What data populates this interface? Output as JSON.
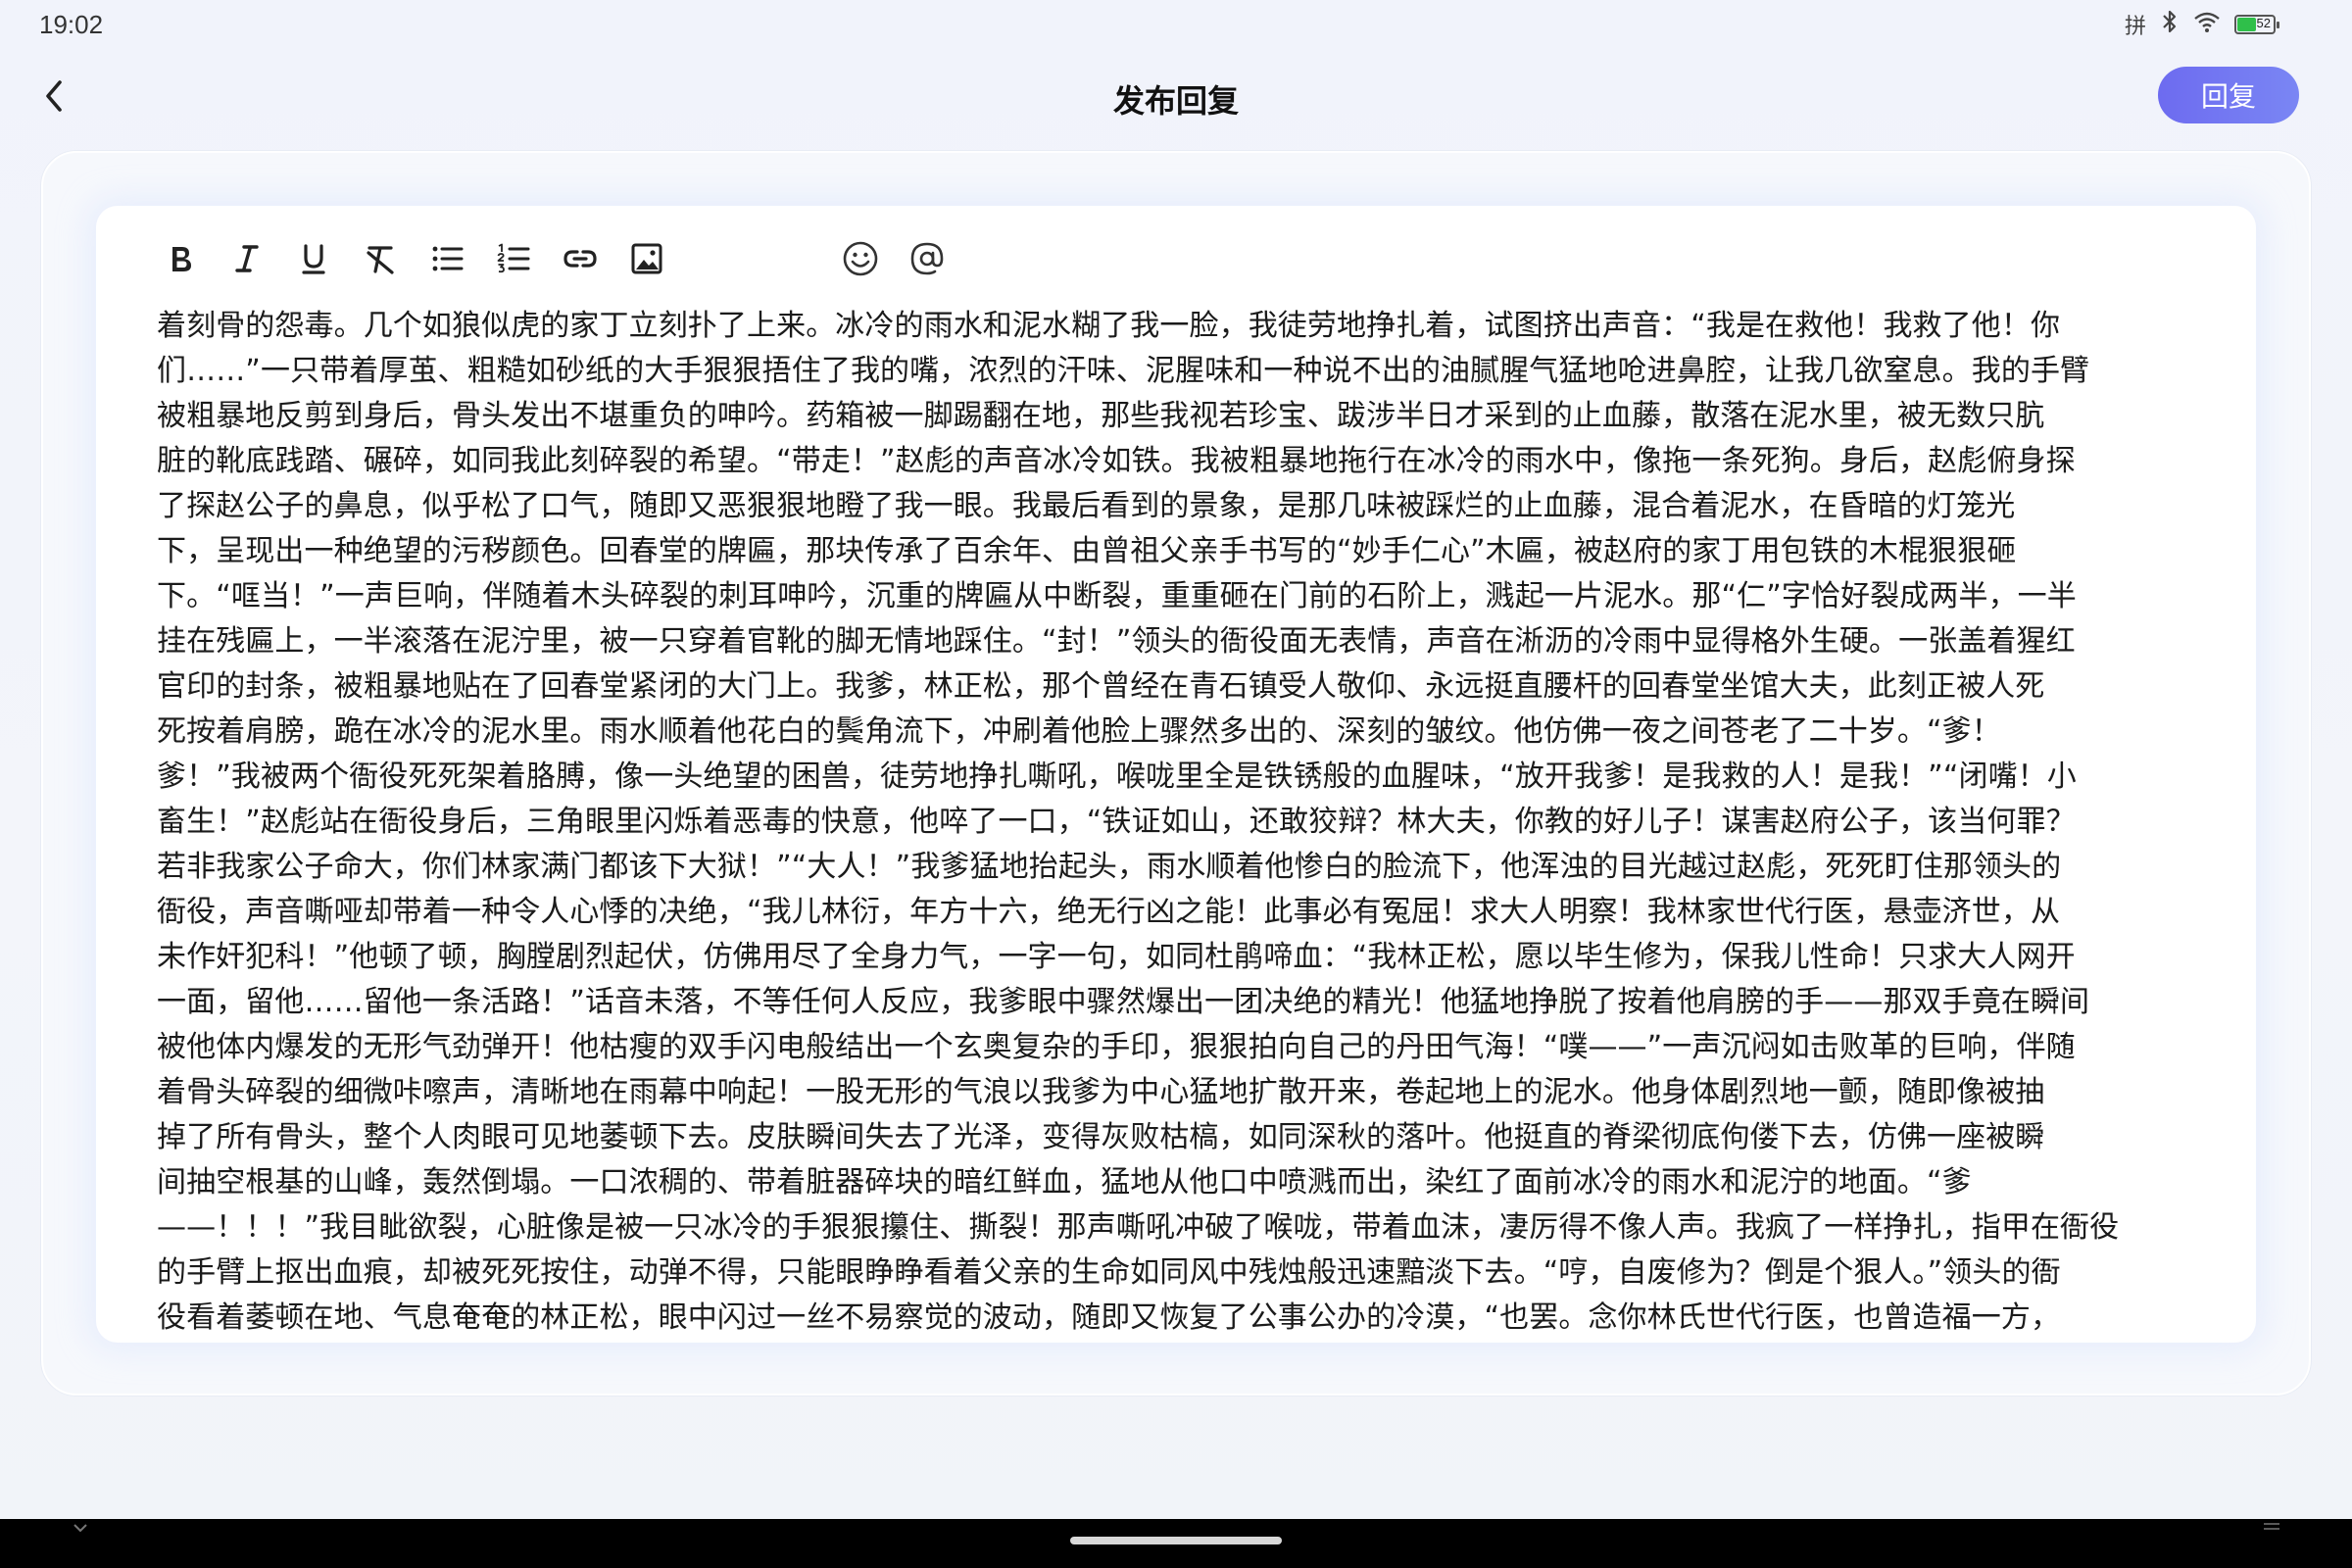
{
  "status_bar": {
    "time": "19:02",
    "input_method": "拼",
    "battery_level": "52",
    "battery_fraction": 0.52,
    "icons": [
      "bluetooth-icon",
      "wifi-icon",
      "battery-icon"
    ]
  },
  "header": {
    "title": "发布回复",
    "reply_label": "回复",
    "accent_color": "#6d6bf0"
  },
  "toolbar": {
    "tools": [
      "bold",
      "italic",
      "underline",
      "clear-format",
      "bullet-list",
      "numbered-list",
      "link",
      "image",
      "emoji",
      "mention"
    ]
  },
  "editor": {
    "lines": [
      "着刻骨的怨毒。几个如狼似虎的家丁立刻扑了上来。冰冷的雨水和泥水糊了我一脸，我徒劳地挣扎着，试图挤出声音：“我是在救他！我救了他！你",
      "们……”一只带着厚茧、粗糙如砂纸的大手狠狠捂住了我的嘴，浓烈的汗味、泥腥味和一种说不出的油腻腥气猛地呛进鼻腔，让我几欲窒息。我的手臂",
      "被粗暴地反剪到身后，骨头发出不堪重负的呻吟。药箱被一脚踢翻在地，那些我视若珍宝、跋涉半日才采到的止血藤，散落在泥水里，被无数只肮",
      "脏的靴底践踏、碾碎，如同我此刻碎裂的希望。“带走！”赵彪的声音冰冷如铁。我被粗暴地拖行在冰冷的雨水中，像拖一条死狗。身后，赵彪俯身探",
      "了探赵公子的鼻息，似乎松了口气，随即又恶狠狠地瞪了我一眼。我最后看到的景象，是那几味被踩烂的止血藤，混合着泥水，在昏暗的灯笼光",
      "下，呈现出一种绝望的污秽颜色。回春堂的牌匾，那块传承了百余年、由曾祖父亲手书写的“妙手仁心”木匾，被赵府的家丁用包铁的木棍狠狠砸",
      "下。“哐当！”一声巨响，伴随着木头碎裂的刺耳呻吟，沉重的牌匾从中断裂，重重砸在门前的石阶上，溅起一片泥水。那“仁”字恰好裂成两半，一半",
      "挂在残匾上，一半滚落在泥泞里，被一只穿着官靴的脚无情地踩住。“封！”领头的衙役面无表情，声音在淅沥的冷雨中显得格外生硬。一张盖着猩红",
      "官印的封条，被粗暴地贴在了回春堂紧闭的大门上。我爹，林正松，那个曾经在青石镇受人敬仰、永远挺直腰杆的回春堂坐馆大夫，此刻正被人死",
      "死按着肩膀，跪在冰冷的泥水里。雨水顺着他花白的鬓角流下，冲刷着他脸上骤然多出的、深刻的皱纹。他仿佛一夜之间苍老了二十岁。“爹！",
      "爹！”我被两个衙役死死架着胳膊，像一头绝望的困兽，徒劳地挣扎嘶吼，喉咙里全是铁锈般的血腥味，“放开我爹！是我救的人！是我！”“闭嘴！小",
      "畜生！”赵彪站在衙役身后，三角眼里闪烁着恶毒的快意，他啐了一口，“铁证如山，还敢狡辩？林大夫，你教的好儿子！谋害赵府公子，该当何罪？",
      "若非我家公子命大，你们林家满门都该下大狱！”“大人！”我爹猛地抬起头，雨水顺着他惨白的脸流下，他浑浊的目光越过赵彪，死死盯住那领头的",
      "衙役，声音嘶哑却带着一种令人心悸的决绝，“我儿林衍，年方十六，绝无行凶之能！此事必有冤屈！求大人明察！我林家世代行医，悬壶济世，从",
      "未作奸犯科！”他顿了顿，胸膛剧烈起伏，仿佛用尽了全身力气，一字一句，如同杜鹃啼血：“我林正松，愿以毕生修为，保我儿性命！只求大人网开",
      "一面，留他……留他一条活路！”话音未落，不等任何人反应，我爹眼中骤然爆出一团决绝的精光！他猛地挣脱了按着他肩膀的手——那双手竟在瞬间",
      "被他体内爆发的无形气劲弹开！他枯瘦的双手闪电般结出一个玄奥复杂的手印，狠狠拍向自己的丹田气海！“噗——”一声沉闷如击败革的巨响，伴随",
      "着骨头碎裂的细微咔嚓声，清晰地在雨幕中响起！一股无形的气浪以我爹为中心猛地扩散开来，卷起地上的泥水。他身体剧烈地一颤，随即像被抽",
      "掉了所有骨头，整个人肉眼可见地萎顿下去。皮肤瞬间失去了光泽，变得灰败枯槁，如同深秋的落叶。他挺直的脊梁彻底佝偻下去，仿佛一座被瞬",
      "间抽空根基的山峰，轰然倒塌。一口浓稠的、带着脏器碎块的暗红鲜血，猛地从他口中喷溅而出，染红了面前冰冷的雨水和泥泞的地面。“爹",
      "——！！！”我目眦欲裂，心脏像是被一只冰冷的手狠狠攥住、撕裂！那声嘶吼冲破了喉咙，带着血沫，凄厉得不像人声。我疯了一样挣扎，指甲在衙役",
      "的手臂上抠出血痕，却被死死按住，动弹不得，只能眼睁睁看着父亲的生命如同风中残烛般迅速黯淡下去。“哼，自废修为？倒是个狠人。”领头的衙",
      "役看着萎顿在地、气息奄奄的林正松，眼中闪过一丝不易察觉的波动，随即又恢复了公事公办的冷漠，“也罢。念你林氏世代行医，也曾造福一方，"
    ]
  }
}
